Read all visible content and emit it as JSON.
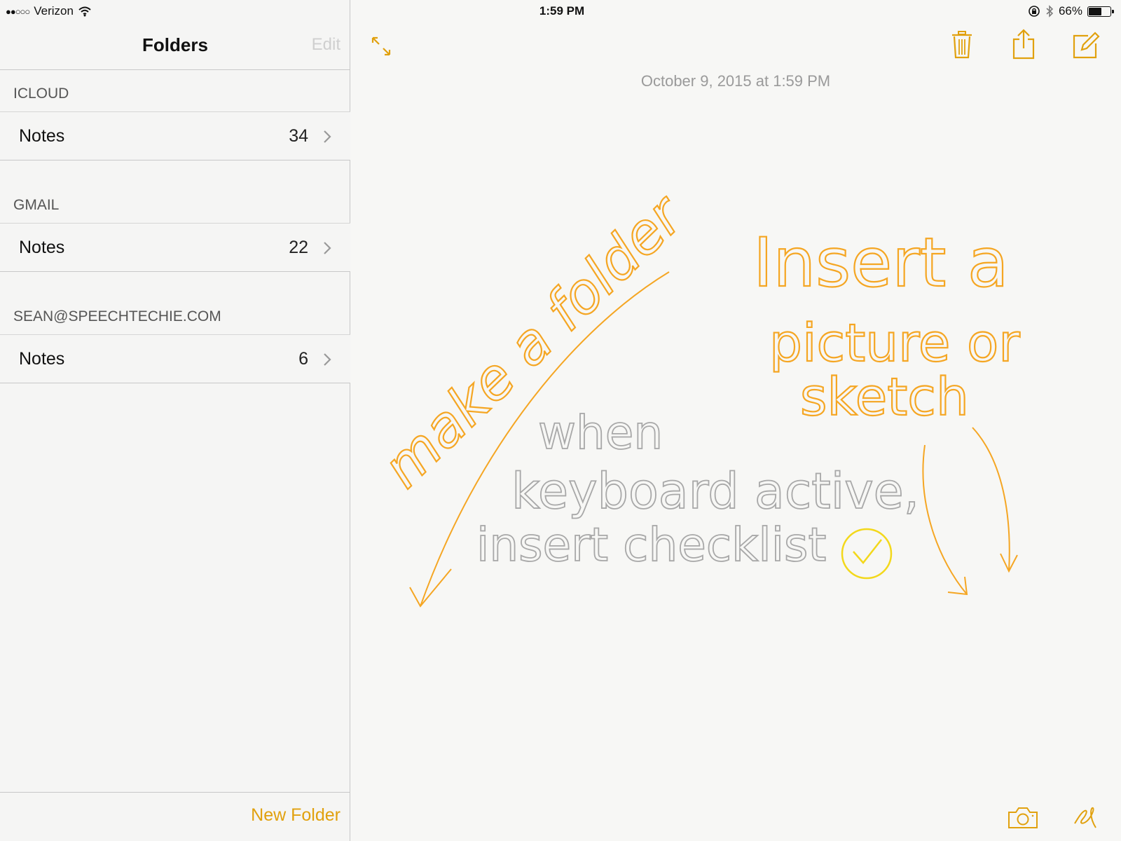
{
  "status_bar": {
    "carrier": "Verizon",
    "signal": "●●○○○",
    "time": "1:59 PM",
    "battery": "66%",
    "battery_level": 0.66
  },
  "sidebar": {
    "title": "Folders",
    "edit_label": "Edit",
    "new_folder_label": "New Folder",
    "sections": [
      {
        "header": "ICLOUD",
        "folders": [
          {
            "label": "Notes",
            "count": "34"
          }
        ]
      },
      {
        "header": "GMAIL",
        "folders": [
          {
            "label": "Notes",
            "count": "22"
          }
        ]
      },
      {
        "header": "SEAN@SPEECHTECHIE.COM",
        "folders": [
          {
            "label": "Notes",
            "count": "6"
          }
        ]
      }
    ]
  },
  "note": {
    "timestamp": "October 9, 2015 at 1:59 PM",
    "handwriting": {
      "make_folder": "make a folder",
      "insert_line1": "Insert a",
      "insert_line2": "picture or",
      "insert_line3": "sketch",
      "when": "when",
      "keyboard": "keyboard active,",
      "checklist": "insert checklist"
    }
  },
  "colors": {
    "accent": "#e1a10e",
    "ink_orange": "#f5a623",
    "ink_gray": "#a8a8a8",
    "ink_yellow": "#f3d81b"
  },
  "icons": {
    "expand": "expand-arrows-icon",
    "trash": "trash-icon",
    "share": "share-icon",
    "compose": "compose-icon",
    "camera": "camera-icon",
    "sketch": "sketch-squiggle-icon"
  }
}
